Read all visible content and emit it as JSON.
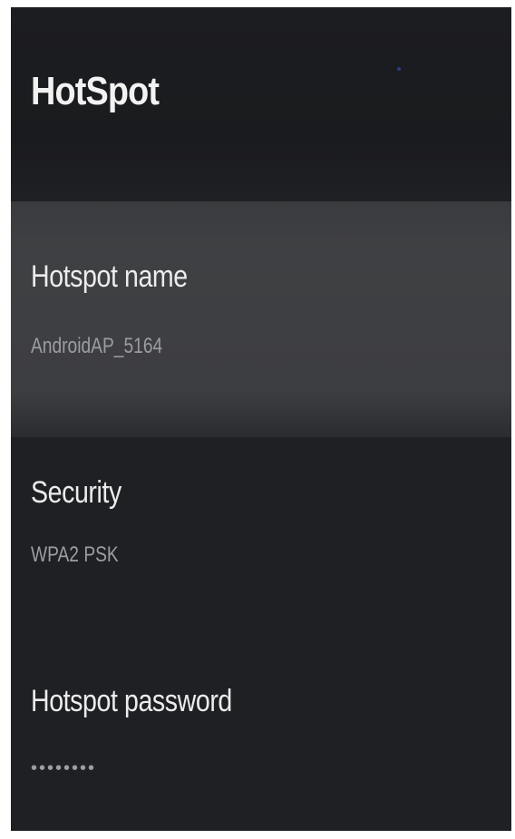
{
  "page": {
    "title": "HotSpot"
  },
  "settings": {
    "items": [
      {
        "title": "Hotspot name",
        "value": "AndroidAP_5164",
        "focused": true
      },
      {
        "title": "Security",
        "value": "WPA2 PSK",
        "focused": false
      },
      {
        "title": "Hotspot password",
        "value": "••••••••",
        "masked": true,
        "focused": false
      }
    ]
  },
  "colors": {
    "background": "#1f2024",
    "focused_row": "#3e3f42",
    "title_text": "#f2f2f2",
    "secondary_text": "#9c9da0"
  }
}
